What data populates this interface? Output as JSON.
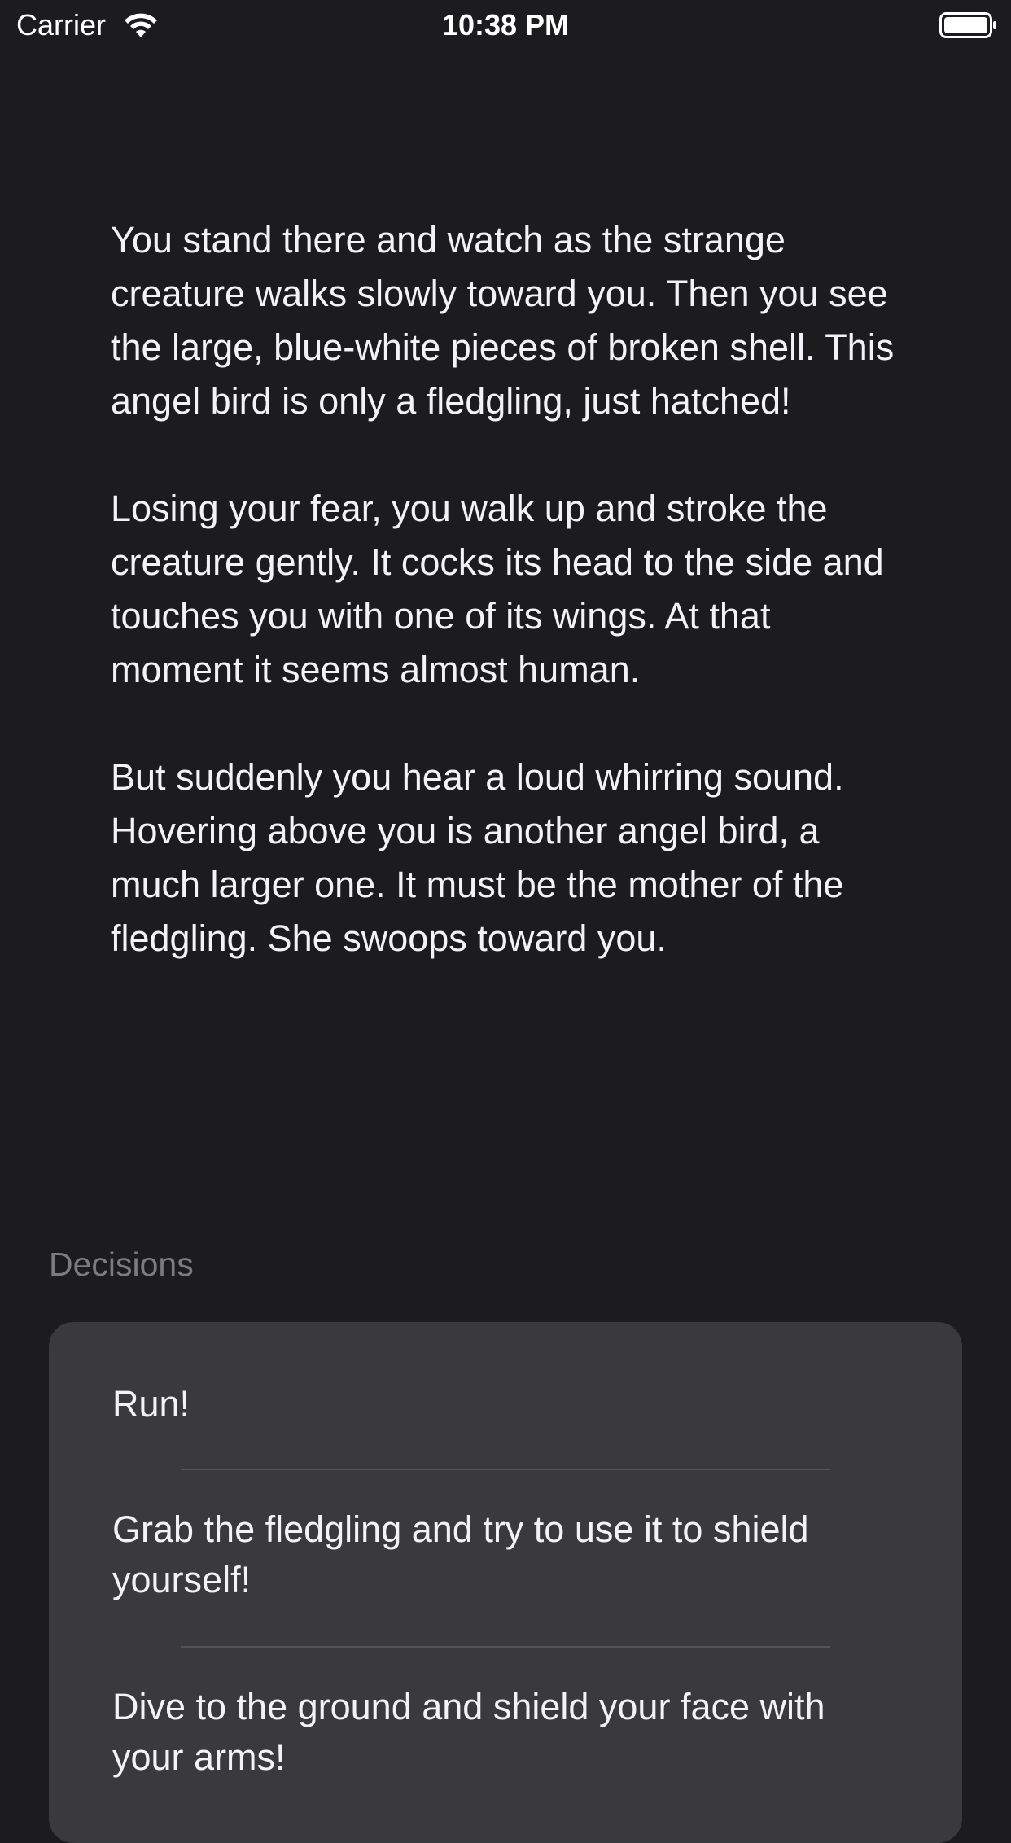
{
  "status_bar": {
    "carrier": "Carrier",
    "time": "10:38 PM",
    "icons": [
      "wifi-icon",
      "battery-icon"
    ]
  },
  "story": {
    "paragraphs": [
      "You stand there and watch as the strange creature walks slowly toward you. Then you see the large, blue-white pieces of broken shell. This angel bird is only a fledgling, just hatched!",
      "Losing your fear, you walk up and stroke the creature gently. It cocks its head to the side and touches you with one of its wings. At that moment it seems almost human.",
      "But suddenly you hear a loud whirring sound. Hovering above you is another angel bird, a much larger one. It must be the mother of the fledgling. She swoops toward you."
    ]
  },
  "decisions": {
    "header": "Decisions",
    "items": [
      "Run!",
      "Grab the fledgling and try to use it to shield yourself!",
      "Dive to the ground and shield your face with your arms!"
    ]
  },
  "colors": {
    "background": "#1c1c1e",
    "card": "#3a3a3c",
    "text": "#f2f2f7",
    "header": "#7c7c80",
    "separator": "#545458"
  }
}
